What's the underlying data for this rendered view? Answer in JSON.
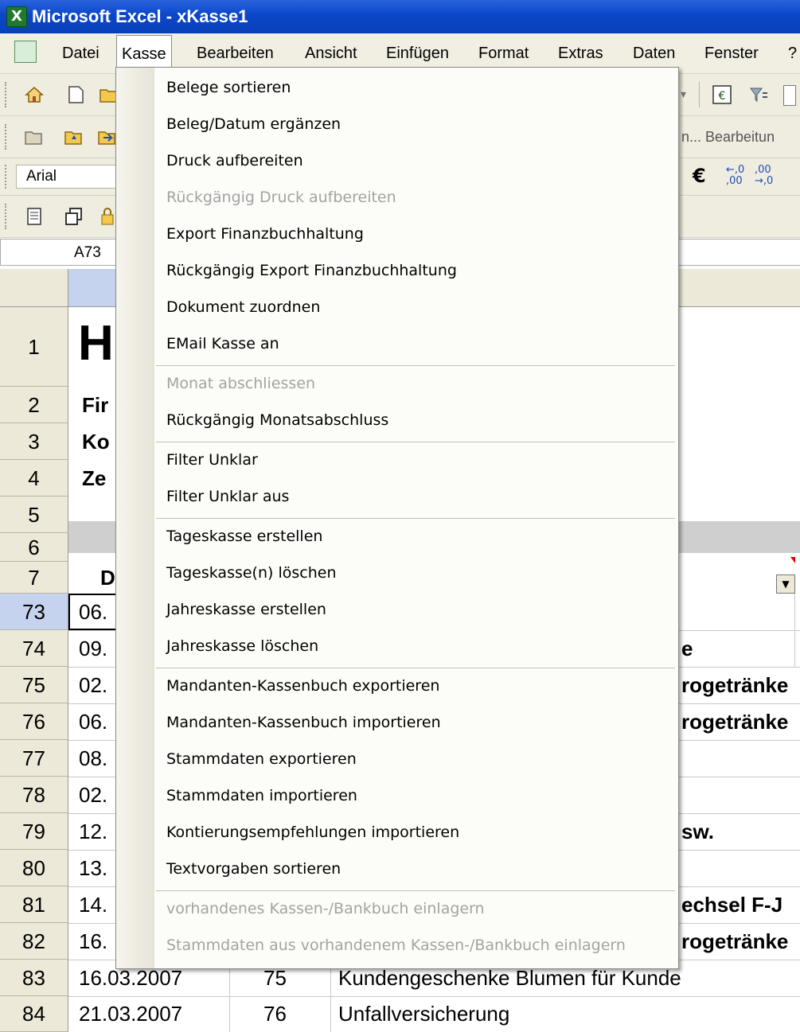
{
  "window": {
    "title": "Microsoft Excel - xKasse1"
  },
  "menubar": {
    "items": [
      "Datei",
      "Kasse",
      "Bearbeiten",
      "Ansicht",
      "Einfügen",
      "Format",
      "Extras",
      "Daten",
      "Fenster",
      "?"
    ],
    "active": "Kasse"
  },
  "toolbar": {
    "font_name": "Arial",
    "partial_labels": [
      "n... Bearbeitun"
    ]
  },
  "formula_bar": {
    "name_box": "A73"
  },
  "kasse_menu": {
    "items": [
      {
        "label": "Belege sortieren",
        "enabled": true
      },
      {
        "label": "Beleg/Datum ergänzen",
        "enabled": true
      },
      {
        "label": "Druck aufbereiten",
        "enabled": true
      },
      {
        "label": "Rückgängig Druck aufbereiten",
        "enabled": false
      },
      {
        "label": "Export Finanzbuchhaltung",
        "enabled": true
      },
      {
        "label": "Rückgängig Export Finanzbuchhaltung",
        "enabled": true
      },
      {
        "label": "Dokument zuordnen",
        "enabled": true
      },
      {
        "label": "EMail Kasse an",
        "enabled": true
      },
      {
        "label": "Monat abschliessen",
        "enabled": false
      },
      {
        "label": "Rückgängig Monatsabschluss",
        "enabled": true
      },
      {
        "label": "Filter Unklar",
        "enabled": true
      },
      {
        "label": "Filter Unklar aus",
        "enabled": true
      },
      {
        "label": "Tageskasse erstellen",
        "enabled": true
      },
      {
        "label": "Tageskasse(n) löschen",
        "enabled": true
      },
      {
        "label": "Jahreskasse erstellen",
        "enabled": true
      },
      {
        "label": "Jahreskasse löschen",
        "enabled": true
      },
      {
        "label": "Mandanten-Kassenbuch exportieren",
        "enabled": true
      },
      {
        "label": "Mandanten-Kassenbuch importieren",
        "enabled": true
      },
      {
        "label": "Stammdaten exportieren",
        "enabled": true
      },
      {
        "label": "Stammdaten importieren",
        "enabled": true
      },
      {
        "label": "Kontierungsempfehlungen importieren",
        "enabled": true
      },
      {
        "label": "Textvorgaben sortieren",
        "enabled": true
      },
      {
        "label": "vorhandenes Kassen-/Bankbuch einlagern",
        "enabled": false
      },
      {
        "label": "Stammdaten aus vorhandenem Kassen-/Bankbuch einlagern",
        "enabled": false
      }
    ]
  },
  "sheet": {
    "rows": [
      {
        "num": "1",
        "a": "H",
        "right": ""
      },
      {
        "num": "2",
        "a": "Fir",
        "right": ""
      },
      {
        "num": "3",
        "a": "Ko",
        "right": ""
      },
      {
        "num": "4",
        "a": "Ze",
        "right": ""
      },
      {
        "num": "5",
        "a": "",
        "right": ""
      },
      {
        "num": "6",
        "a": "",
        "right": ""
      },
      {
        "num": "7",
        "a": "D",
        "right": ""
      },
      {
        "num": "73",
        "a": "06.",
        "right": ""
      },
      {
        "num": "74",
        "a": "09.",
        "right": "e"
      },
      {
        "num": "75",
        "a": "02.",
        "right": "rogetränke"
      },
      {
        "num": "76",
        "a": "06.",
        "right": "rogetränke"
      },
      {
        "num": "77",
        "a": "08.",
        "right": ""
      },
      {
        "num": "78",
        "a": "02.",
        "right": ""
      },
      {
        "num": "79",
        "a": "12.",
        "right": "sw."
      },
      {
        "num": "80",
        "a": "13.",
        "right": ""
      },
      {
        "num": "81",
        "a": "14.",
        "right": "echsel F-J"
      },
      {
        "num": "82",
        "a": "16.",
        "right": "rogetränke"
      },
      {
        "num": "83",
        "a": "16.03.2007",
        "b": "75",
        "c": "Kundengeschenke Blumen für Kunde"
      },
      {
        "num": "84",
        "a": "21.03.2007",
        "b": "76",
        "c": "Unfallversicherung"
      }
    ]
  },
  "colors": {
    "titlebar": "#0a47c9",
    "menubar": "#f1efe2",
    "selected_row": "#c6d3ef",
    "disabled_text": "#a3a3a3"
  }
}
